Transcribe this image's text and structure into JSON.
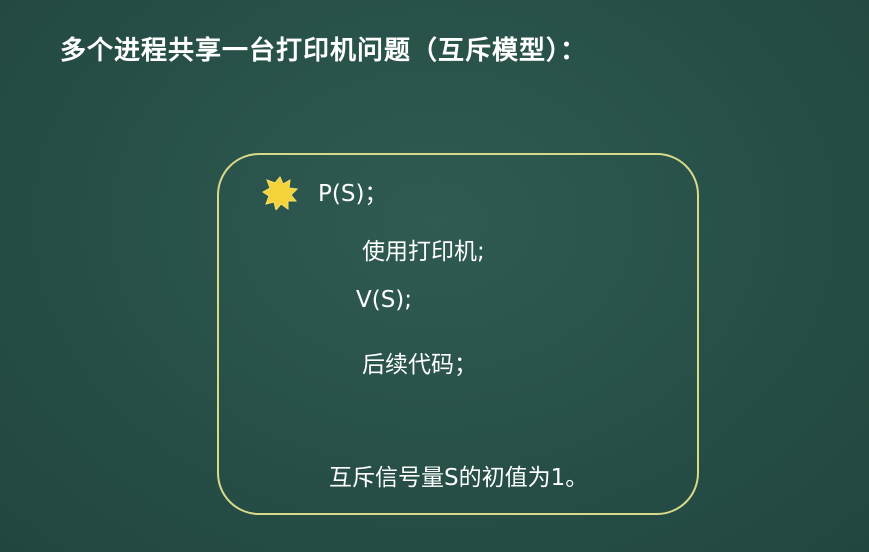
{
  "slide": {
    "title": "多个进程共享一台打印机问题（互斥模型）：",
    "bullet_icon": "sun-star-icon",
    "code": {
      "line1": "P(S)；",
      "line2": "使用打印机;",
      "line3": "V(S);",
      "line4": "后续代码；",
      "note": "互斥信号量S的初值为1。"
    },
    "colors": {
      "background": "#274f47",
      "box_border": "#d9d98a",
      "star": "#f3d23a",
      "text": "#ffffff"
    }
  }
}
